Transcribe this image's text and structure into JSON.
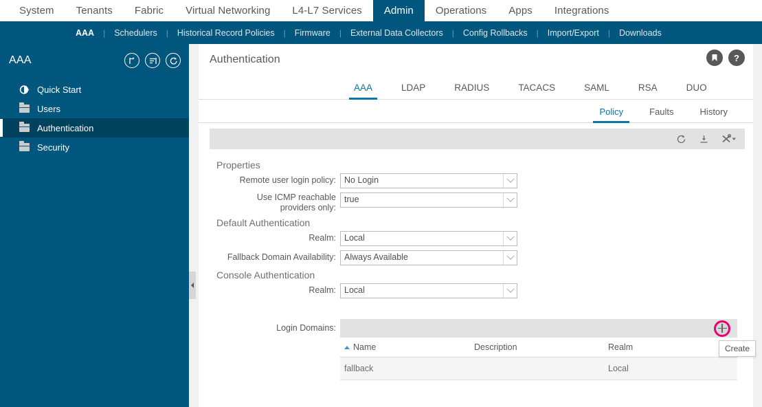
{
  "colors": {
    "nav_blue": "#00567d",
    "sidebar_selected": "#01425f",
    "accent_teal": "#0d74a5",
    "highlight_pink": "#e8006f",
    "toolbar_grey": "#e2e2e2"
  },
  "topnav": {
    "items": [
      {
        "label": "System",
        "active": false
      },
      {
        "label": "Tenants",
        "active": false
      },
      {
        "label": "Fabric",
        "active": false
      },
      {
        "label": "Virtual Networking",
        "active": false
      },
      {
        "label": "L4-L7 Services",
        "active": false
      },
      {
        "label": "Admin",
        "active": true
      },
      {
        "label": "Operations",
        "active": false
      },
      {
        "label": "Apps",
        "active": false
      },
      {
        "label": "Integrations",
        "active": false
      }
    ]
  },
  "subnav": {
    "items": [
      {
        "label": "AAA",
        "active": true
      },
      {
        "label": "Schedulers",
        "active": false
      },
      {
        "label": "Historical Record Policies",
        "active": false
      },
      {
        "label": "Firmware",
        "active": false
      },
      {
        "label": "External Data Collectors",
        "active": false
      },
      {
        "label": "Config Rollbacks",
        "active": false
      },
      {
        "label": "Import/Export",
        "active": false
      },
      {
        "label": "Downloads",
        "active": false
      }
    ],
    "separator": "|"
  },
  "sidebar": {
    "title": "AAA",
    "header_icons": [
      {
        "name": "collapse-all-icon"
      },
      {
        "name": "filter-list-icon"
      },
      {
        "name": "refresh-icon"
      }
    ],
    "items": [
      {
        "label": "Quick Start",
        "icon": "quick-start-icon",
        "selected": false
      },
      {
        "label": "Users",
        "icon": "folder-icon",
        "selected": false
      },
      {
        "label": "Authentication",
        "icon": "folder-icon",
        "selected": true
      },
      {
        "label": "Security",
        "icon": "folder-icon",
        "selected": false
      }
    ]
  },
  "content": {
    "page_title": "Authentication",
    "header_icons": [
      {
        "name": "bookmark-icon",
        "glyph": "⚑"
      },
      {
        "name": "help-icon",
        "glyph": "?"
      }
    ],
    "tabs": [
      {
        "label": "AAA",
        "active": true
      },
      {
        "label": "LDAP",
        "active": false
      },
      {
        "label": "RADIUS",
        "active": false
      },
      {
        "label": "TACACS",
        "active": false
      },
      {
        "label": "SAML",
        "active": false
      },
      {
        "label": "RSA",
        "active": false
      },
      {
        "label": "DUO",
        "active": false
      }
    ],
    "subtabs": [
      {
        "label": "Policy",
        "active": true
      },
      {
        "label": "Faults",
        "active": false
      },
      {
        "label": "History",
        "active": false
      }
    ],
    "toolbar_icons": [
      {
        "name": "refresh-icon"
      },
      {
        "name": "download-icon"
      },
      {
        "name": "tools-icon"
      }
    ]
  },
  "form": {
    "properties_heading": "Properties",
    "default_auth_heading": "Default Authentication",
    "console_auth_heading": "Console Authentication",
    "fields": [
      {
        "label": "Remote user login policy:",
        "value": "No Login"
      },
      {
        "label": "Use ICMP reachable providers only:",
        "label_line1": "Use ICMP reachable",
        "label_line2": "providers only:",
        "value": "true"
      },
      {
        "label": "Realm:",
        "value": "Local"
      },
      {
        "label": "Fallback Domain Availability:",
        "value": "Always Available"
      },
      {
        "label": "Realm:",
        "value": "Local"
      }
    ]
  },
  "login_domains": {
    "label": "Login Domains:",
    "create_tooltip": "Create",
    "add_button_name": "add-login-domain-button",
    "columns": [
      "Name",
      "Description",
      "Realm"
    ],
    "sort_column": "Name",
    "rows": [
      {
        "name": "fallback",
        "description": "",
        "realm": "Local"
      }
    ]
  }
}
